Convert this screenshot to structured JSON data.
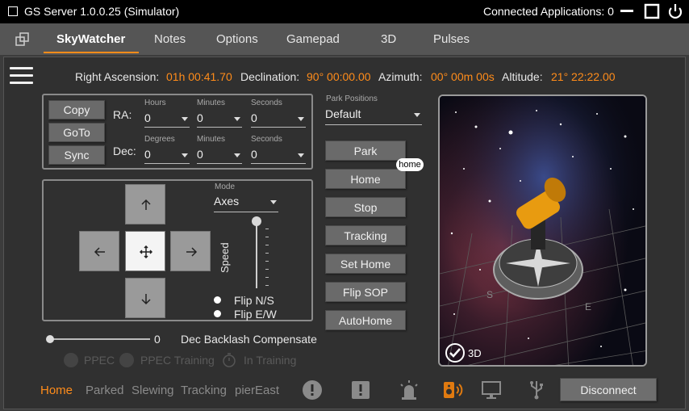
{
  "titlebar": {
    "title": "GS Server 1.0.0.25 (Simulator)",
    "connected": "Connected Applications: 0"
  },
  "tabs": [
    "SkyWatcher",
    "Notes",
    "Options",
    "Gamepad",
    "3D",
    "Pulses"
  ],
  "coords": {
    "ra_label": "Right Ascension:",
    "ra_value": "01h 00:41.70",
    "dec_label": "Declination:",
    "dec_value": "90° 00:00.00",
    "az_label": "Azimuth:",
    "az_value": "00° 00m 00s",
    "alt_label": "Altitude:",
    "alt_value": "21° 22:22.00"
  },
  "goto": {
    "copy": "Copy",
    "goto": "GoTo",
    "sync": "Sync",
    "ra": "RA:",
    "dec": "Dec:",
    "hours": "Hours",
    "minutes": "Minutes",
    "seconds": "Seconds",
    "degrees": "Degrees",
    "ra_h": "0",
    "ra_m": "0",
    "ra_s": "0",
    "dec_d": "0",
    "dec_m": "0",
    "dec_s": "0"
  },
  "park": {
    "label": "Park Positions",
    "value": "Default",
    "buttons": [
      "Park",
      "Home",
      "Stop",
      "Tracking",
      "Set Home",
      "Flip SOP",
      "AutoHome"
    ],
    "home_badge": "home"
  },
  "slew": {
    "mode_label": "Mode",
    "mode_value": "Axes",
    "speed": "Speed",
    "flip_ns": "Flip N/S",
    "flip_ew": "Flip E/W"
  },
  "backlash": {
    "value": "0",
    "label": "Dec Backlash Compensate"
  },
  "ppec": {
    "ppec": "PPEC",
    "training": "PPEC Training",
    "in_training": "In Training"
  },
  "view3d": {
    "label": "3D"
  },
  "status": {
    "home": "Home",
    "parked": "Parked",
    "slewing": "Slewing",
    "tracking": "Tracking",
    "pier": "pierEast",
    "disconnect": "Disconnect"
  },
  "colors": {
    "accent": "#ff8c1a"
  }
}
